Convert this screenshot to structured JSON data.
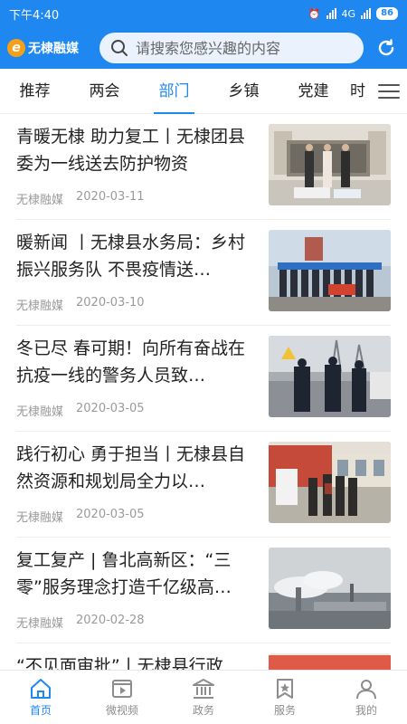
{
  "status_bar": {
    "time": "下午4:40",
    "network": "4G",
    "battery": "86"
  },
  "app_bar": {
    "logo_text": "无棣融媒",
    "search_placeholder": "请搜索您感兴趣的内容"
  },
  "tabs": [
    {
      "label": "推荐",
      "active": false
    },
    {
      "label": "两会",
      "active": false
    },
    {
      "label": "部门",
      "active": true
    },
    {
      "label": "乡镇",
      "active": false
    },
    {
      "label": "党建",
      "active": false
    },
    {
      "label": "时",
      "active": false
    }
  ],
  "articles": [
    {
      "title": "青暖无棣 助力复工丨无棣团县委为一线送去防护物资",
      "source": "无棣融媒",
      "date": "2020-03-11"
    },
    {
      "title": "暖新闻 丨无棣县水务局：乡村振兴服务队 不畏疫情送…",
      "source": "无棣融媒",
      "date": "2020-03-10"
    },
    {
      "title": "冬已尽 春可期！向所有奋战在抗疫一线的警务人员致…",
      "source": "无棣融媒",
      "date": "2020-03-05"
    },
    {
      "title": "践行初心 勇于担当丨无棣县自然资源和规划局全力以…",
      "source": "无棣融媒",
      "date": "2020-03-05"
    },
    {
      "title": "复工复产 | 鲁北高新区：“三零”服务理念打造千亿级高…",
      "source": "无棣融媒",
      "date": "2020-02-28"
    },
    {
      "title": "“不见面审批”丨无棣县行政",
      "source": "",
      "date": ""
    }
  ],
  "bottom_nav": [
    {
      "label": "首页",
      "icon": "home-icon",
      "active": true
    },
    {
      "label": "微视频",
      "icon": "video-icon",
      "active": false
    },
    {
      "label": "政务",
      "icon": "government-icon",
      "active": false
    },
    {
      "label": "服务",
      "icon": "service-icon",
      "active": false
    },
    {
      "label": "我的",
      "icon": "user-icon",
      "active": false
    }
  ],
  "colors": {
    "accent": "#1e88f0",
    "text": "#222222",
    "meta": "#9a9a9a"
  }
}
